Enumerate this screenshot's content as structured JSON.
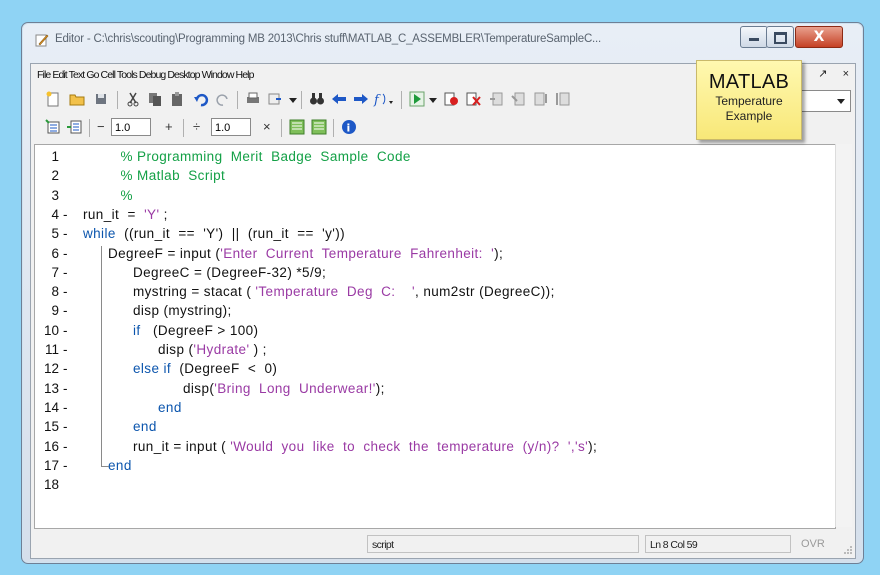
{
  "window": {
    "title": "Editor - C:\\chris\\scouting\\Programming MB 2013\\Chris stuff\\MATLAB_C_ASSEMBLER\\TemperatureSampleC...",
    "close_label": "X"
  },
  "menubar": {
    "text": "File Edit Text Go Cell Tools Debug Desktop Window Help",
    "right_controls": [
      "↘",
      "↗",
      "×"
    ]
  },
  "toolbar2": {
    "minus": "−",
    "plus": "+",
    "divide": "÷",
    "times": "×",
    "value1": "1.0",
    "value2": "1.0"
  },
  "tooltip": {
    "title": "MATLAB",
    "line1": "Temperature",
    "line2": "Example"
  },
  "code_lines": [
    {
      "num": "1",
      "mark": "",
      "indent": 3,
      "parts": [
        [
          "cm",
          "% Programming  Merit  Badge  Sample  Code"
        ]
      ]
    },
    {
      "num": "2",
      "mark": "",
      "indent": 3,
      "parts": [
        [
          "cm",
          "% Matlab  Script"
        ]
      ]
    },
    {
      "num": "3",
      "mark": "",
      "indent": 3,
      "parts": [
        [
          "cm",
          "%"
        ]
      ]
    },
    {
      "num": "4",
      "mark": "-",
      "indent": 0,
      "parts": [
        [
          "",
          "run_it  =  "
        ],
        [
          "str",
          "'Y'"
        ],
        [
          "",
          " ;"
        ]
      ]
    },
    {
      "num": "5",
      "mark": "-",
      "indent": 0,
      "parts": [
        [
          "kw",
          "while"
        ],
        [
          "",
          "  ((run_it  ==  'Y')  ||  (run_it  ==  'y'))"
        ]
      ]
    },
    {
      "num": "6",
      "mark": "-",
      "indent": 2,
      "parts": [
        [
          "",
          "DegreeF = input ("
        ],
        [
          "str",
          "'Enter  Current  Temperature  Fahrenheit:  '"
        ],
        [
          "",
          ");"
        ]
      ]
    },
    {
      "num": "7",
      "mark": "-",
      "indent": 4,
      "parts": [
        [
          "",
          "DegreeC = (DegreeF-32) *5/9;"
        ]
      ]
    },
    {
      "num": "8",
      "mark": "-",
      "indent": 4,
      "parts": [
        [
          "",
          "mystring = stacat ( "
        ],
        [
          "str",
          "'Temperature  Deg  C:    '"
        ],
        [
          "",
          ", num2str (DegreeC));"
        ]
      ]
    },
    {
      "num": "9",
      "mark": "-",
      "indent": 4,
      "parts": [
        [
          "",
          "disp (mystring);"
        ]
      ]
    },
    {
      "num": "10",
      "mark": "-",
      "indent": 4,
      "parts": [
        [
          "kw",
          "if"
        ],
        [
          "",
          "   (DegreeF > 100)"
        ]
      ]
    },
    {
      "num": "11",
      "mark": "-",
      "indent": 6,
      "parts": [
        [
          "",
          "disp ("
        ],
        [
          "str",
          "'Hydrate'"
        ],
        [
          "",
          " ) ;"
        ]
      ]
    },
    {
      "num": "12",
      "mark": "-",
      "indent": 4,
      "parts": [
        [
          "kw",
          "else if"
        ],
        [
          "",
          "  (DegreeF  <  0)"
        ]
      ]
    },
    {
      "num": "13",
      "mark": "-",
      "indent": 8,
      "parts": [
        [
          "",
          "disp("
        ],
        [
          "str",
          "'Bring  Long  Underwear!'"
        ],
        [
          "",
          ");"
        ]
      ]
    },
    {
      "num": "14",
      "mark": "-",
      "indent": 6,
      "parts": [
        [
          "kw",
          "end"
        ]
      ]
    },
    {
      "num": "15",
      "mark": "-",
      "indent": 4,
      "parts": [
        [
          "kw",
          "end"
        ]
      ]
    },
    {
      "num": "16",
      "mark": "-",
      "indent": 4,
      "parts": [
        [
          "",
          "run_it = input ( "
        ],
        [
          "str",
          "'Would  you  like  to  check  the  temperature  (y/n)?  ','s'"
        ],
        [
          "",
          ");"
        ]
      ]
    },
    {
      "num": "17",
      "mark": "-",
      "indent": 2,
      "parts": [
        [
          "kw",
          "end"
        ]
      ]
    },
    {
      "num": "18",
      "mark": "",
      "indent": 0,
      "parts": []
    }
  ],
  "status": {
    "mode": "script",
    "position": "Ln 8 Col 59",
    "ovr": "OVR"
  },
  "colors": {
    "keyword": "#0b55ad",
    "string": "#9a3aa4",
    "comment": "#13a046",
    "background": "#8fd3f4"
  }
}
